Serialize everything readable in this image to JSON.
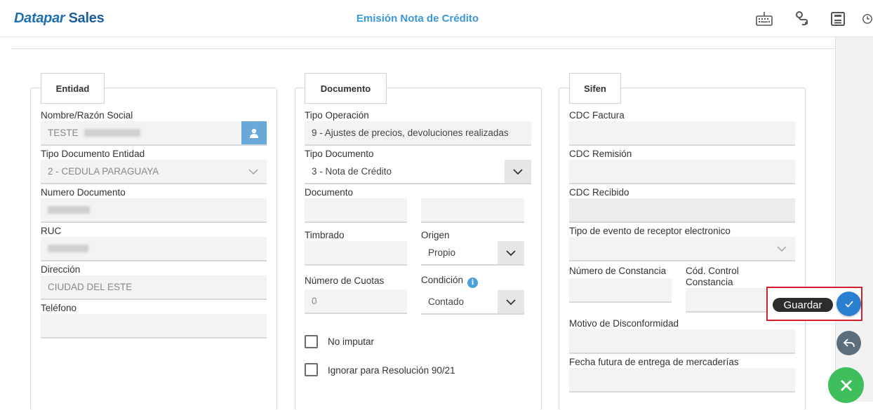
{
  "app": {
    "brand_part1": "Datapar",
    "brand_part2": "Sales",
    "page_title": "Emisión Nota de Crédito"
  },
  "colors": {
    "brand": "#1e6fb4",
    "title": "#3a97d8",
    "save": "#2b7fd1",
    "close": "#3fbf5c",
    "highlight": "#d31f2b"
  },
  "toolbar": {
    "icons": [
      "keyboard-icon",
      "route-icon",
      "save-document-icon",
      "clock-icon"
    ]
  },
  "entidad": {
    "legend": "Entidad",
    "nombre_label": "Nombre/Razón Social",
    "nombre_value": "TESTE",
    "tipo_doc_label": "Tipo Documento Entidad",
    "tipo_doc_value": "2 - CEDULA PARAGUAYA",
    "numero_doc_label": "Numero Documento",
    "ruc_label": "RUC",
    "direccion_label": "Dirección",
    "direccion_value": "CIUDAD DEL ESTE",
    "telefono_label": "Teléfono"
  },
  "documento": {
    "legend": "Documento",
    "tipo_op_label": "Tipo Operación",
    "tipo_op_value": "9 - Ajustes de precios, devoluciones realizadas",
    "tipo_doc_label": "Tipo Documento",
    "tipo_doc_value": "3 - Nota de Crédito",
    "documento_label": "Documento",
    "timbrado_label": "Timbrado",
    "origen_label": "Origen",
    "origen_value": "Propio",
    "cuotas_label": "Número de Cuotas",
    "cuotas_value": "0",
    "condicion_label": "Condición",
    "condicion_value": "Contado",
    "no_imputar_label": "No imputar",
    "ignorar_label": "Ignorar para Resolución 90/21"
  },
  "sifen": {
    "legend": "Sifen",
    "cdc_factura_label": "CDC Factura",
    "cdc_remision_label": "CDC Remisión",
    "cdc_recibido_label": "CDC Recibido",
    "tipo_evento_label": "Tipo de evento de receptor electronico",
    "num_constancia_label": "Número de Constancia",
    "cod_control_label_1": "Cód. Control",
    "cod_control_label_2": "Constancia",
    "motivo_label": "Motivo de Disconformidad",
    "fecha_label": "Fecha futura de entrega de mercaderías"
  },
  "actions": {
    "save_tooltip": "Guardar"
  }
}
